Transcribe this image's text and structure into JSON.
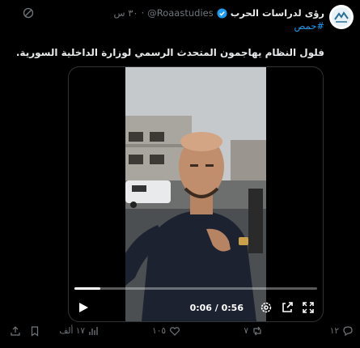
{
  "account": {
    "display_name": "رؤى لدراسات الحرب",
    "handle": "@Roaastudies",
    "dot": "·",
    "time": "٣٠ س"
  },
  "hashtag": "#حمص",
  "tweet_text": "فلول النظام يهاجمون المتحدث الرسمي لوزارة الداخلية السورية.",
  "video": {
    "time_display": "0:06 / 0:56",
    "progress": 0.107
  },
  "actions": {
    "replies": "١٢",
    "reposts": "٧",
    "likes": "١٠٥",
    "views": "١٧ ألف"
  },
  "colors": {
    "accent": "#1d9bf0",
    "muted": "#71767b",
    "text": "#e7e9ea",
    "background": "#000000"
  },
  "icons": [
    "avatar-logo",
    "verified-badge-icon",
    "grok-icon",
    "play-icon",
    "settings-icon",
    "popout-icon",
    "fullscreen-icon",
    "reply-icon",
    "repost-icon",
    "like-icon",
    "views-icon",
    "bookmark-icon",
    "share-icon"
  ]
}
